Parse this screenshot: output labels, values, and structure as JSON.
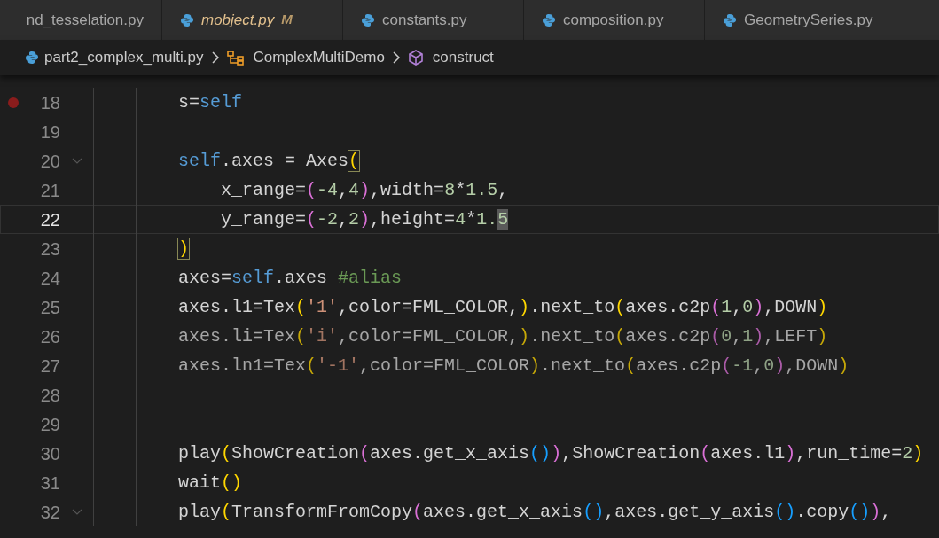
{
  "tabs": [
    {
      "label": "nd_tesselation.py",
      "selected": false,
      "preview": false
    },
    {
      "label": "mobject.py",
      "selected": false,
      "preview": true,
      "badge": "M"
    },
    {
      "label": "constants.py",
      "selected": false,
      "preview": false
    },
    {
      "label": "composition.py",
      "selected": false,
      "preview": false
    },
    {
      "label": "GeometrySeries.py",
      "selected": false,
      "preview": false
    }
  ],
  "breadcrumb": [
    {
      "kind": "file",
      "label": "part2_complex_multi.py"
    },
    {
      "kind": "class",
      "label": "ComplexMultiDemo"
    },
    {
      "kind": "method",
      "label": "construct"
    }
  ],
  "lines": [
    {
      "number": "18",
      "breakpoint": true,
      "current": false,
      "foldable": false,
      "dim": false,
      "tokens": [
        {
          "text": "s=",
          "kind": "plain"
        },
        {
          "text": "self",
          "kind": "keyword"
        }
      ]
    },
    {
      "number": "19",
      "breakpoint": false,
      "current": false,
      "foldable": false
    },
    {
      "number": "20",
      "breakpoint": false,
      "current": false,
      "foldable": true,
      "dim": false,
      "tokens": [
        {
          "text": "self",
          "kind": "keyword"
        },
        {
          "text": ".axes = Axes",
          "kind": "plain"
        },
        {
          "text": "(",
          "kind": "paren1",
          "bracket_match": true
        }
      ]
    },
    {
      "number": "21",
      "breakpoint": false,
      "current": false,
      "foldable": false,
      "dim": false,
      "tokens": [
        {
          "text": "    x_range=",
          "kind": "plain"
        },
        {
          "text": "(",
          "kind": "paren2"
        },
        {
          "text": "-4",
          "kind": "number"
        },
        {
          "text": ",",
          "kind": "plain"
        },
        {
          "text": "4",
          "kind": "number"
        },
        {
          "text": ")",
          "kind": "paren2"
        },
        {
          "text": ",width=",
          "kind": "plain"
        },
        {
          "text": "8",
          "kind": "number"
        },
        {
          "text": "*",
          "kind": "plain"
        },
        {
          "text": "1.5",
          "kind": "number"
        },
        {
          "text": ",",
          "kind": "plain"
        }
      ]
    },
    {
      "number": "22",
      "breakpoint": false,
      "current": true,
      "foldable": false,
      "dim": false,
      "tokens": [
        {
          "text": "    y_range=",
          "kind": "plain"
        },
        {
          "text": "(",
          "kind": "paren2"
        },
        {
          "text": "-2",
          "kind": "number"
        },
        {
          "text": ",",
          "kind": "plain"
        },
        {
          "text": "2",
          "kind": "number"
        },
        {
          "text": ")",
          "kind": "paren2"
        },
        {
          "text": ",height=",
          "kind": "plain"
        },
        {
          "text": "4",
          "kind": "number"
        },
        {
          "text": "*",
          "kind": "plain"
        },
        {
          "text": "1.",
          "kind": "number"
        },
        {
          "text": "5",
          "kind": "number",
          "selected": true
        }
      ]
    },
    {
      "number": "23",
      "breakpoint": false,
      "current": false,
      "foldable": false,
      "dim": false,
      "tokens": [
        {
          "text": ")",
          "kind": "paren1",
          "bracket_match": true
        }
      ]
    },
    {
      "number": "24",
      "breakpoint": false,
      "current": false,
      "foldable": false,
      "dim": false,
      "tokens": [
        {
          "text": "axes=",
          "kind": "plain"
        },
        {
          "text": "self",
          "kind": "keyword"
        },
        {
          "text": ".axes ",
          "kind": "plain"
        },
        {
          "text": "#alias",
          "kind": "comment"
        }
      ]
    },
    {
      "number": "25",
      "breakpoint": false,
      "current": false,
      "foldable": false,
      "dim": false,
      "tokens": [
        {
          "text": "axes.l1=Tex",
          "kind": "plain"
        },
        {
          "text": "(",
          "kind": "paren1"
        },
        {
          "text": "'1'",
          "kind": "string"
        },
        {
          "text": ",color=FML_COLOR,",
          "kind": "plain"
        },
        {
          "text": ")",
          "kind": "paren1"
        },
        {
          "text": ".next_to",
          "kind": "plain"
        },
        {
          "text": "(",
          "kind": "paren1"
        },
        {
          "text": "axes.c2p",
          "kind": "plain"
        },
        {
          "text": "(",
          "kind": "paren2"
        },
        {
          "text": "1",
          "kind": "number"
        },
        {
          "text": ",",
          "kind": "plain"
        },
        {
          "text": "0",
          "kind": "number"
        },
        {
          "text": ")",
          "kind": "paren2"
        },
        {
          "text": ",DOWN",
          "kind": "plain"
        },
        {
          "text": ")",
          "kind": "paren1"
        }
      ]
    },
    {
      "number": "26",
      "breakpoint": false,
      "current": false,
      "foldable": false,
      "dim": true,
      "tokens": [
        {
          "text": "axes.li=Tex",
          "kind": "plain"
        },
        {
          "text": "(",
          "kind": "paren1"
        },
        {
          "text": "'i'",
          "kind": "string"
        },
        {
          "text": ",color=FML_COLOR,",
          "kind": "plain"
        },
        {
          "text": ")",
          "kind": "paren1"
        },
        {
          "text": ".next_to",
          "kind": "plain"
        },
        {
          "text": "(",
          "kind": "paren1"
        },
        {
          "text": "axes.c2p",
          "kind": "plain"
        },
        {
          "text": "(",
          "kind": "paren2"
        },
        {
          "text": "0",
          "kind": "number"
        },
        {
          "text": ",",
          "kind": "plain"
        },
        {
          "text": "1",
          "kind": "number"
        },
        {
          "text": ")",
          "kind": "paren2"
        },
        {
          "text": ",LEFT",
          "kind": "plain"
        },
        {
          "text": ")",
          "kind": "paren1"
        }
      ]
    },
    {
      "number": "27",
      "breakpoint": false,
      "current": false,
      "foldable": false,
      "dim": true,
      "tokens": [
        {
          "text": "axes.ln1=Tex",
          "kind": "plain"
        },
        {
          "text": "(",
          "kind": "paren1"
        },
        {
          "text": "'-1'",
          "kind": "string"
        },
        {
          "text": ",color=FML_COLOR",
          "kind": "plain"
        },
        {
          "text": ")",
          "kind": "paren1"
        },
        {
          "text": ".next_to",
          "kind": "plain"
        },
        {
          "text": "(",
          "kind": "paren1"
        },
        {
          "text": "axes.c2p",
          "kind": "plain"
        },
        {
          "text": "(",
          "kind": "paren2"
        },
        {
          "text": "-1",
          "kind": "number"
        },
        {
          "text": ",",
          "kind": "plain"
        },
        {
          "text": "0",
          "kind": "number"
        },
        {
          "text": ")",
          "kind": "paren2"
        },
        {
          "text": ",DOWN",
          "kind": "plain"
        },
        {
          "text": ")",
          "kind": "paren1"
        }
      ]
    },
    {
      "number": "28",
      "breakpoint": false,
      "current": false,
      "foldable": false
    },
    {
      "number": "29",
      "breakpoint": false,
      "current": false,
      "foldable": false
    },
    {
      "number": "30",
      "breakpoint": false,
      "current": false,
      "foldable": false,
      "dim": false,
      "tokens": [
        {
          "text": "play",
          "kind": "plain"
        },
        {
          "text": "(",
          "kind": "paren1"
        },
        {
          "text": "ShowCreation",
          "kind": "plain"
        },
        {
          "text": "(",
          "kind": "paren2"
        },
        {
          "text": "axes.get_x_axis",
          "kind": "plain"
        },
        {
          "text": "()",
          "kind": "paren3"
        },
        {
          "text": ")",
          "kind": "paren2"
        },
        {
          "text": ",ShowCreation",
          "kind": "plain"
        },
        {
          "text": "(",
          "kind": "paren2"
        },
        {
          "text": "axes.l1",
          "kind": "plain"
        },
        {
          "text": ")",
          "kind": "paren2"
        },
        {
          "text": ",run_time=",
          "kind": "plain"
        },
        {
          "text": "2",
          "kind": "number"
        },
        {
          "text": ")",
          "kind": "paren1"
        }
      ]
    },
    {
      "number": "31",
      "breakpoint": false,
      "current": false,
      "foldable": false,
      "dim": false,
      "tokens": [
        {
          "text": "wait",
          "kind": "plain"
        },
        {
          "text": "()",
          "kind": "paren1"
        }
      ]
    },
    {
      "number": "32",
      "breakpoint": false,
      "current": false,
      "foldable": true,
      "dim": false,
      "tokens": [
        {
          "text": "play",
          "kind": "plain"
        },
        {
          "text": "(",
          "kind": "paren1"
        },
        {
          "text": "TransformFromCopy",
          "kind": "plain"
        },
        {
          "text": "(",
          "kind": "paren2"
        },
        {
          "text": "axes.get_x_axis",
          "kind": "plain"
        },
        {
          "text": "()",
          "kind": "paren3"
        },
        {
          "text": ",axes.get_y_axis",
          "kind": "plain"
        },
        {
          "text": "()",
          "kind": "paren3"
        },
        {
          "text": ".copy",
          "kind": "plain"
        },
        {
          "text": "()",
          "kind": "paren3"
        },
        {
          "text": ")",
          "kind": "paren2"
        },
        {
          "text": ",",
          "kind": "plain"
        }
      ]
    }
  ]
}
